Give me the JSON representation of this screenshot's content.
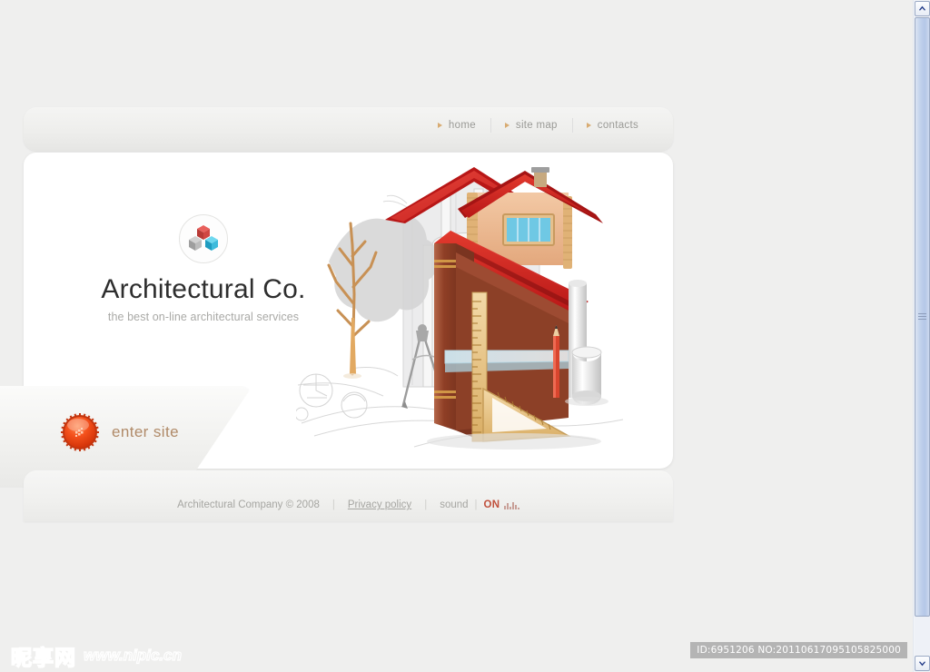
{
  "nav": {
    "items": [
      {
        "label": "home",
        "icon": "arrow-bullet-icon"
      },
      {
        "label": "site map",
        "icon": "arrow-bullet-icon"
      },
      {
        "label": "contacts",
        "icon": "arrow-bullet-icon"
      }
    ]
  },
  "brand": {
    "logo_icon": "three-cubes-logo-icon",
    "name": "Architectural Co.",
    "tagline": "the best on-line architectural services",
    "cube_colors": {
      "top": "#d9534f",
      "left": "#b8b8b8",
      "right": "#3bbfdd"
    }
  },
  "illustration": {
    "name": "architecture-house-cutaway-illustration",
    "roof_color": "#d32020",
    "wall_color": "#9c4a2a",
    "accent_color": "#e8b97a",
    "sketch_color": "#d3d3d3",
    "tree_color": "#c8955c"
  },
  "enter": {
    "label": "enter site",
    "orb_icon": "gear-orb-icon",
    "orb_color": "#e8470f",
    "label_color": "#b08a68"
  },
  "footer": {
    "copyright": "Architectural Company © 2008",
    "privacy_label": "Privacy policy",
    "sound_label": "sound",
    "sound_state": "ON",
    "sound_state_color": "#c0503c",
    "equalizer_icon": "equalizer-bars-icon",
    "separator": "|"
  },
  "watermark": {
    "logo_cn": "昵享网",
    "url": "www.nipic.cn",
    "id_text": "ID:6951206 NO:20110617095105825000"
  },
  "scrollbar": {
    "up_icon": "chevron-up-icon",
    "down_icon": "chevron-down-icon",
    "thumb_icon": "scrollbar-grip-icon"
  },
  "theme": {
    "page_background": "#efefee",
    "panel_background": "#ffffff",
    "muted_text": "#a6a6a2"
  }
}
